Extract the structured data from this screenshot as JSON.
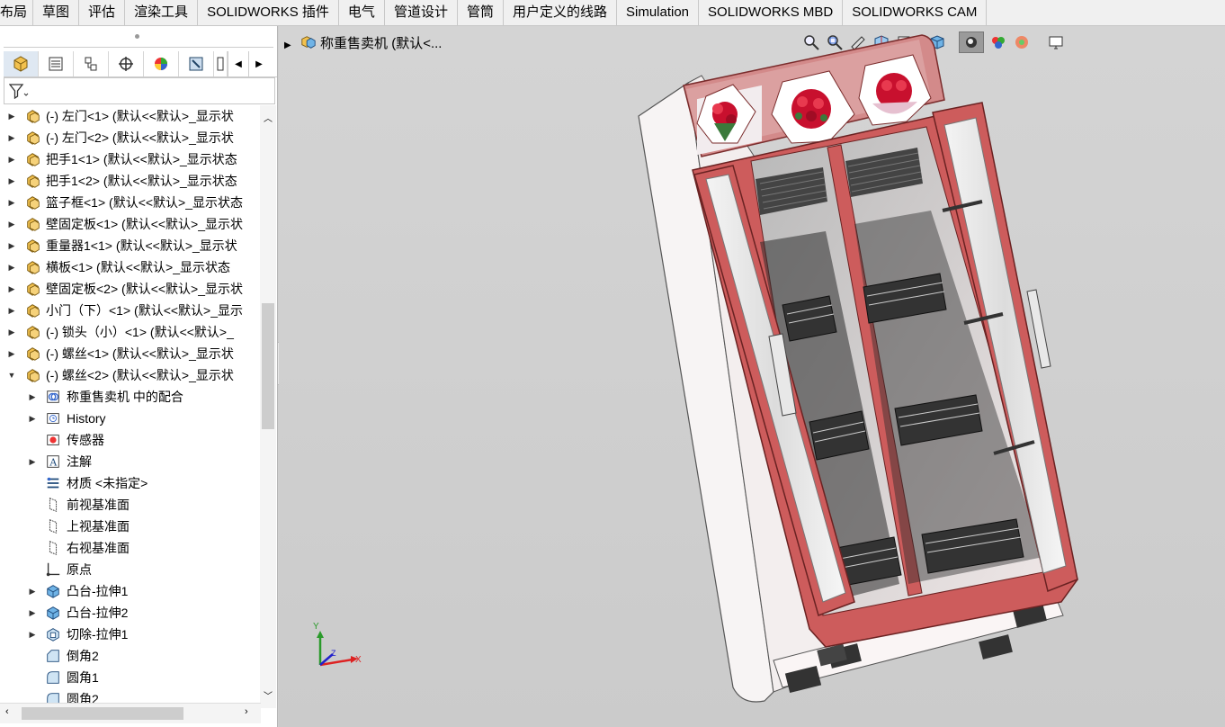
{
  "ribbon_tabs": [
    "布局",
    "草图",
    "评估",
    "渲染工具",
    "SOLIDWORKS 插件",
    "电气",
    "管道设计",
    "管筒",
    "用户定义的线路",
    "Simulation",
    "SOLIDWORKS MBD",
    "SOLIDWORKS CAM"
  ],
  "breadcrumb": "称重售卖机 (默认<...",
  "tree": {
    "components": [
      "(-) 左门<1> (默认<<默认>_显示状",
      "(-) 左门<2> (默认<<默认>_显示状",
      "把手1<1> (默认<<默认>_显示状态",
      "把手1<2> (默认<<默认>_显示状态",
      "篮子框<1> (默认<<默认>_显示状态",
      "壁固定板<1> (默认<<默认>_显示状",
      "重量器1<1> (默认<<默认>_显示状",
      "横板<1> (默认<<默认>_显示状态",
      "壁固定板<2> (默认<<默认>_显示状",
      "小门（下）<1> (默认<<默认>_显示",
      "(-) 锁头（小）<1> (默认<<默认>_",
      "(-) 螺丝<1> (默认<<默认>_显示状",
      "(-) 螺丝<2> (默认<<默认>_显示状"
    ],
    "children": [
      {
        "label": "称重售卖机 中的配合",
        "icon": "mates-icon",
        "expandable": true
      },
      {
        "label": "History",
        "icon": "history-icon",
        "expandable": true
      },
      {
        "label": "传感器",
        "icon": "sensor-icon",
        "expandable": false
      },
      {
        "label": "注解",
        "icon": "annotation-icon",
        "expandable": true
      },
      {
        "label": "材质 <未指定>",
        "icon": "material-icon",
        "expandable": false
      },
      {
        "label": "前视基准面",
        "icon": "plane-icon",
        "expandable": false
      },
      {
        "label": "上视基准面",
        "icon": "plane-icon",
        "expandable": false
      },
      {
        "label": "右视基准面",
        "icon": "plane-icon",
        "expandable": false
      },
      {
        "label": "原点",
        "icon": "origin-icon",
        "expandable": false
      },
      {
        "label": "凸台-拉伸1",
        "icon": "extrude-icon",
        "expandable": true
      },
      {
        "label": "凸台-拉伸2",
        "icon": "extrude-icon",
        "expandable": true
      },
      {
        "label": "切除-拉伸1",
        "icon": "cut-extrude-icon",
        "expandable": true
      },
      {
        "label": "倒角2",
        "icon": "chamfer-icon",
        "expandable": false
      },
      {
        "label": "圆角1",
        "icon": "fillet-icon",
        "expandable": false
      },
      {
        "label": "圆角2",
        "icon": "fillet-icon",
        "expandable": false
      }
    ]
  },
  "triad": {
    "x": "X",
    "y": "Y",
    "z": "Z"
  },
  "colors": {
    "cabinet_red": "#cd5c5c",
    "cabinet_white": "#f7f4f4",
    "accent": "#1e5aa8"
  }
}
